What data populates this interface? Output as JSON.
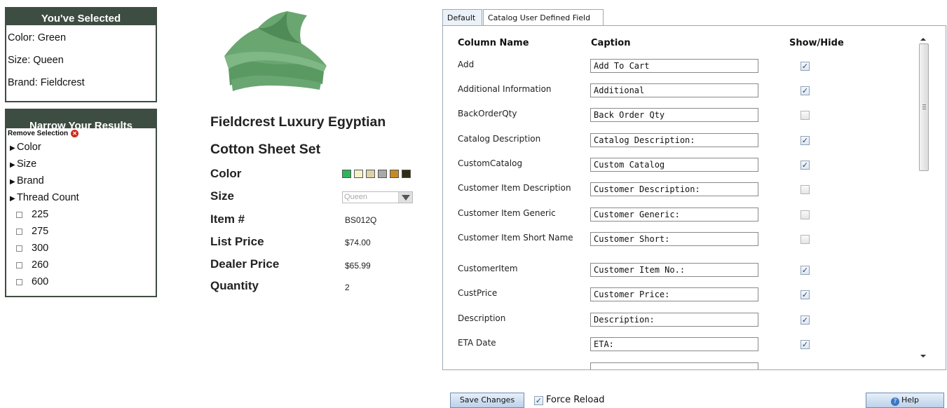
{
  "selected": {
    "header": "You've Selected",
    "lines": [
      "Color: Green",
      "Size: Queen",
      "Brand: Fieldcrest"
    ]
  },
  "narrow": {
    "header": "Narrow Your Results",
    "remove_label": "Remove Selection",
    "facets": [
      "Color",
      "Size",
      "Brand",
      "Thread Count"
    ],
    "thread_counts": [
      "225",
      "275",
      "300",
      "260",
      "600"
    ]
  },
  "product": {
    "title_line1": "Fieldcrest Luxury Egyptian",
    "title_line2": "Cotton Sheet Set",
    "color_label": "Color",
    "size_label": "Size",
    "size_value": "Queen",
    "item_label": "Item #",
    "item_value": "BS012Q",
    "list_price_label": "List Price",
    "list_price_value": "$74.00",
    "dealer_price_label": "Dealer Price",
    "dealer_price_value": "$65.99",
    "quantity_label": "Quantity",
    "quantity_value": "2",
    "swatches": [
      "#2db659",
      "#f4f1c4",
      "#ddd1a8",
      "#a9a9a9",
      "#c68a24",
      "#2e2d14"
    ],
    "image_color": "#5d9a65"
  },
  "tabs": [
    "Default",
    "Catalog User Defined Field"
  ],
  "grid": {
    "col_name": "Column Name",
    "col_caption": "Caption",
    "col_show": "Show/Hide",
    "rows": [
      {
        "name": "Add",
        "caption": "Add To Cart",
        "show": true
      },
      {
        "name": "Additional Information",
        "caption": "Additional",
        "show": true
      },
      {
        "name": "BackOrderQty",
        "caption": "Back Order Qty",
        "show": false
      },
      {
        "name": "Catalog Description",
        "caption": "Catalog Description:",
        "show": true
      },
      {
        "name": "CustomCatalog",
        "caption": "Custom Catalog",
        "show": true
      },
      {
        "name": "Customer Item Description",
        "caption": "Customer Description:",
        "show": false
      },
      {
        "name": "Customer Item Generic",
        "caption": "Customer Generic:",
        "show": false
      },
      {
        "name": "Customer Item Short Name",
        "caption": "Customer Short:",
        "show": false
      },
      {
        "name": "CustomerItem",
        "caption": "Customer Item No.:",
        "show": true
      },
      {
        "name": "CustPrice",
        "caption": "Customer Price:",
        "show": true
      },
      {
        "name": "Description",
        "caption": "Description:",
        "show": true
      },
      {
        "name": "ETA Date",
        "caption": "ETA:",
        "show": true
      }
    ]
  },
  "footer": {
    "save_label": "Save Changes",
    "force_reload_label": "Force Reload",
    "force_reload_checked": true,
    "help_label": "Help"
  }
}
